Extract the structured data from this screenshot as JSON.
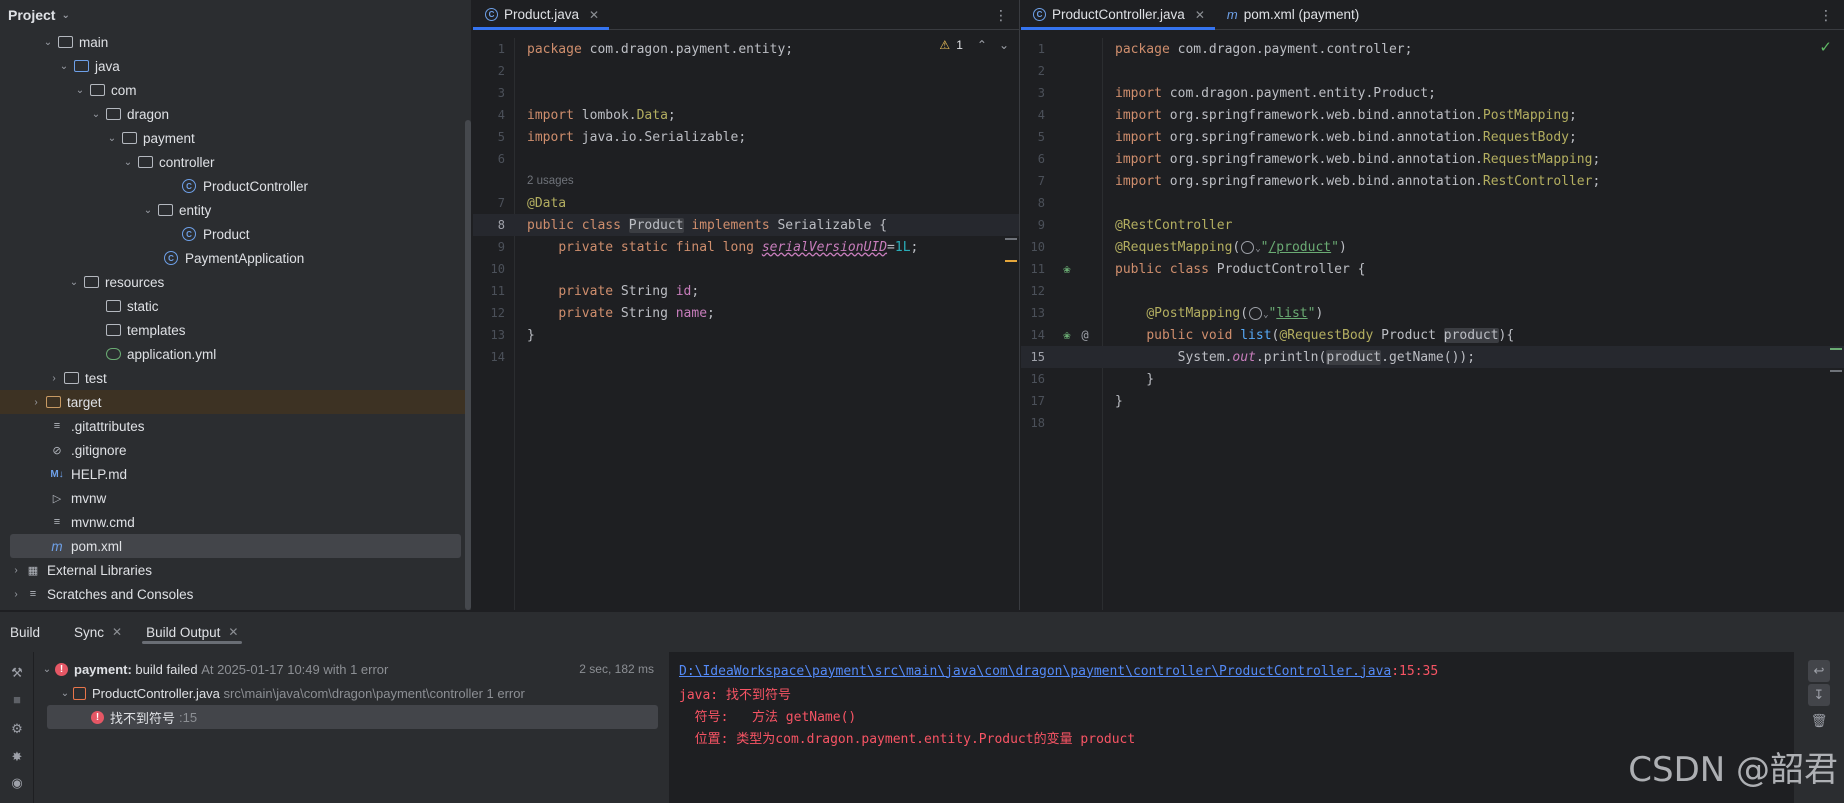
{
  "project": {
    "title": "Project",
    "tree": [
      {
        "label": "main",
        "icon": "folder-icon",
        "expanded": true
      },
      {
        "label": "java",
        "icon": "source-folder-icon",
        "expanded": true
      },
      {
        "label": "com",
        "icon": "package-icon",
        "expanded": true
      },
      {
        "label": "dragon",
        "icon": "package-icon",
        "expanded": true
      },
      {
        "label": "payment",
        "icon": "package-icon",
        "expanded": true
      },
      {
        "label": "controller",
        "icon": "package-icon",
        "expanded": true
      },
      {
        "label": "ProductController",
        "icon": "class-icon"
      },
      {
        "label": "entity",
        "icon": "package-icon",
        "expanded": true
      },
      {
        "label": "Product",
        "icon": "class-icon"
      },
      {
        "label": "PaymentApplication",
        "icon": "spring-class-icon"
      },
      {
        "label": "resources",
        "icon": "resources-folder-icon",
        "expanded": true
      },
      {
        "label": "static",
        "icon": "folder-icon"
      },
      {
        "label": "templates",
        "icon": "folder-icon"
      },
      {
        "label": "application.yml",
        "icon": "yaml-spring-icon"
      },
      {
        "label": "test",
        "icon": "folder-icon",
        "expanded": false
      },
      {
        "label": "target",
        "icon": "excluded-folder-icon",
        "expanded": false
      },
      {
        "label": ".gitattributes",
        "icon": "text-file-icon"
      },
      {
        "label": ".gitignore",
        "icon": "ignore-file-icon"
      },
      {
        "label": "HELP.md",
        "icon": "markdown-icon"
      },
      {
        "label": "mvnw",
        "icon": "terminal-file-icon"
      },
      {
        "label": "mvnw.cmd",
        "icon": "text-file-icon"
      },
      {
        "label": "pom.xml",
        "icon": "maven-icon"
      },
      {
        "label": "External Libraries",
        "icon": "libraries-icon",
        "expanded": false
      },
      {
        "label": "Scratches and Consoles",
        "icon": "scratches-icon",
        "expanded": false
      }
    ]
  },
  "left_editor": {
    "tabs": [
      {
        "label": "Product.java",
        "active": true
      }
    ],
    "warnings": {
      "count": "1"
    },
    "usages_hint": "2 usages",
    "lines": [
      "1",
      "2",
      "3",
      "4",
      "5",
      "6",
      "7",
      "8",
      "9",
      "10",
      "11",
      "12",
      "13",
      "14"
    ]
  },
  "right_editor": {
    "tabs": [
      {
        "label": "ProductController.java",
        "active": true
      },
      {
        "label": "pom.xml (payment)",
        "active": false
      }
    ],
    "lines": [
      "1",
      "2",
      "3",
      "4",
      "5",
      "6",
      "7",
      "8",
      "9",
      "10",
      "11",
      "12",
      "13",
      "14",
      "15",
      "16",
      "17",
      "18"
    ]
  },
  "build": {
    "tabs": {
      "title": "Build",
      "sync": "Sync",
      "output": "Build Output"
    },
    "tree": {
      "root_name": "payment:",
      "root_status": "build failed",
      "root_time": "At 2025-01-17 10:49 with 1 error",
      "duration": "2 sec, 182 ms",
      "file_name": "ProductController.java",
      "file_path": "src\\main\\java\\com\\dragon\\payment\\controller 1 error",
      "error_label": "找不到符号",
      "error_line": ":15"
    },
    "output": {
      "link": "D:\\IdeaWorkspace\\payment\\src\\main\\java\\com\\dragon\\payment\\controller\\ProductController.java",
      "link_pos": ":15:35",
      "line1": "java: 找不到符号",
      "line2": "  符号:   方法 getName()",
      "line3": "  位置: 类型为com.dragon.payment.entity.Product的变量 product"
    }
  },
  "watermark": "CSDN @韶君",
  "colors": {
    "accent": "#3574f0",
    "error": "#e55765",
    "warning": "#f2c55c",
    "ok": "#5fb865"
  }
}
